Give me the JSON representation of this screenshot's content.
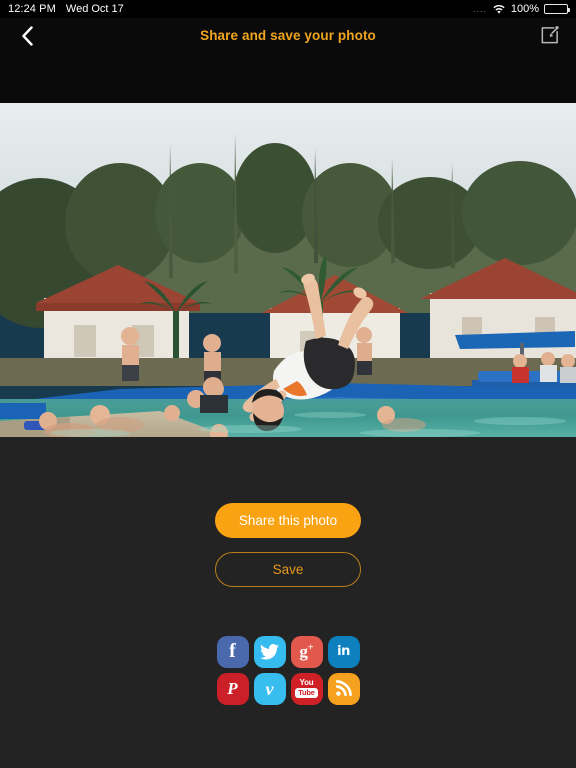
{
  "status_bar": {
    "time": "12:24 PM",
    "date": "Wed Oct 17",
    "signal_dots": "....",
    "wifi_icon": "wifi-icon",
    "battery_percent": "100%",
    "battery_level": 100
  },
  "nav_bar": {
    "back_icon": "chevron-left-icon",
    "title": "Share and save your photo",
    "edit_icon": "compose-edit-icon",
    "title_color": "#f0a51e"
  },
  "photo": {
    "alt": "Man doing a backflip over an outdoor swimming pool with friends watching at a resort",
    "caption": ""
  },
  "actions": {
    "share_label": "Share this photo",
    "save_label": "Save",
    "primary_color": "#f9a312",
    "secondary_text_color": "#e5971b"
  },
  "social": {
    "items": [
      {
        "name": "facebook",
        "icon": "facebook-icon",
        "glyph": "f",
        "color": "#4a69ad",
        "label": "Facebook"
      },
      {
        "name": "twitter",
        "icon": "twitter-icon",
        "glyph": "",
        "color": "#36bbee",
        "label": "Twitter"
      },
      {
        "name": "google-plus",
        "icon": "google-plus-icon",
        "glyph": "g+",
        "color": "#e2584d",
        "label": "Google Plus"
      },
      {
        "name": "linkedin",
        "icon": "linkedin-icon",
        "glyph": "in",
        "color": "#0d80bd",
        "label": "LinkedIn"
      },
      {
        "name": "pinterest",
        "icon": "pinterest-icon",
        "glyph": "P",
        "color": "#cb2027",
        "label": "Pinterest"
      },
      {
        "name": "vimeo",
        "icon": "vimeo-icon",
        "glyph": "v",
        "color": "#38bdef",
        "label": "Vimeo"
      },
      {
        "name": "youtube",
        "icon": "youtube-icon",
        "glyph": "You Tube",
        "color": "#cf2026",
        "label": "YouTube"
      },
      {
        "name": "rss",
        "icon": "rss-icon",
        "glyph": "",
        "color": "#f5a11f",
        "label": "RSS"
      }
    ],
    "youtube_top": "You",
    "youtube_bottom": "Tube"
  },
  "theme": {
    "background": "#232323",
    "bar_background": "#0a0a0a",
    "accent": "#f9a312"
  }
}
